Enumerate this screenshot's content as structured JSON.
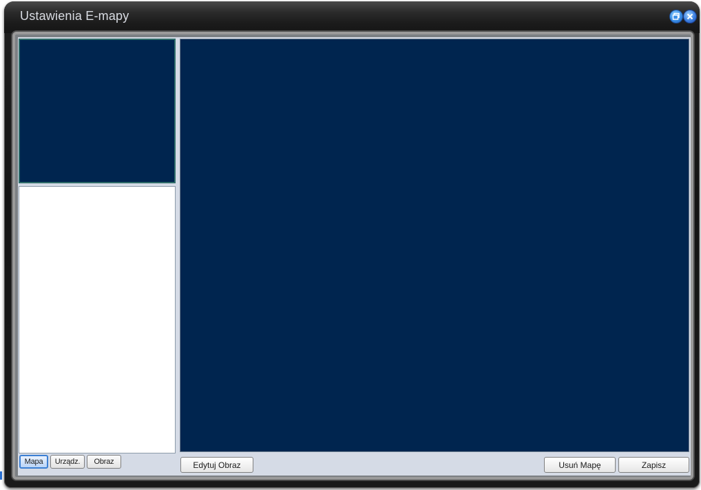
{
  "window": {
    "title": "Ustawienia E-mapy",
    "accent_color": "#00254f"
  },
  "titlebar_buttons": {
    "restore_icon": "restore-icon",
    "close_icon": "close-icon"
  },
  "left_tabs": {
    "items": [
      {
        "label": "Mapa",
        "active": true
      },
      {
        "label": "Urządz.",
        "active": false
      },
      {
        "label": "Obraz",
        "active": false
      }
    ]
  },
  "toolbar": {
    "edit_image_label": "Edytuj Obraz",
    "delete_map_label": "Usuń Mapę",
    "save_label": "Zapisz"
  }
}
